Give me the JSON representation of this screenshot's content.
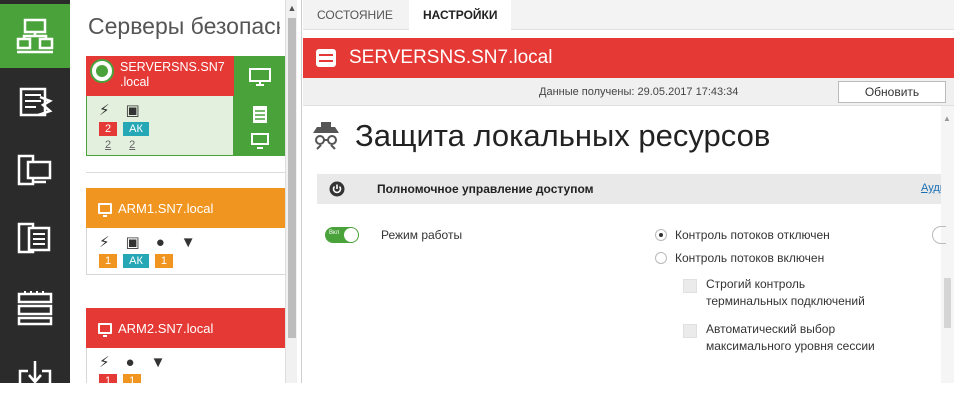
{
  "rail": {
    "items": [
      {
        "name": "network-servers-icon",
        "active": true
      },
      {
        "name": "settings-icon",
        "active": false
      },
      {
        "name": "workstation-icon",
        "active": false
      },
      {
        "name": "server-list-icon",
        "active": false
      },
      {
        "name": "rack-icon",
        "active": false
      },
      {
        "name": "download-icon",
        "active": false
      }
    ]
  },
  "list": {
    "title": "Серверы безопасности",
    "cards": [
      {
        "name_line1": "SERVERSNS.SN7",
        "name_line2": ".local",
        "tags": [
          "2",
          "АК"
        ],
        "subtags": [
          "2",
          "2"
        ]
      },
      {
        "name": "ARM1.SN7.local",
        "tags": [
          "1",
          "АК",
          "1"
        ]
      },
      {
        "name": "ARM2.SN7.local",
        "tags": [
          "1",
          "1"
        ]
      }
    ]
  },
  "tabs": [
    {
      "label": "СОСТОЯНИЕ",
      "active": false
    },
    {
      "label": "НАСТРОЙКИ",
      "active": true
    }
  ],
  "server_bar": {
    "name": "SERVERSNS.SN7.local"
  },
  "received": {
    "text": "Данные получены: 29.05.2017 17:43:34",
    "refresh": "Обновить"
  },
  "page": {
    "title": "Защита локальных ресурсов"
  },
  "section": {
    "title": "Полномочное управление доступом",
    "link": "Аудит"
  },
  "mode": {
    "toggle_label": "Вкл",
    "label": "Режим работы",
    "options": [
      "Контроль потоков отключен",
      "Контроль потоков включен"
    ],
    "selected": 0,
    "checks": [
      [
        "Строгий контроль",
        "терминальных подключений"
      ],
      [
        "Автоматический выбор",
        "максимального уровня сессии"
      ]
    ]
  },
  "colors": {
    "accent": "#4aa23a",
    "danger": "#e53935",
    "warning": "#f0951f",
    "teal": "#26a7b5"
  }
}
